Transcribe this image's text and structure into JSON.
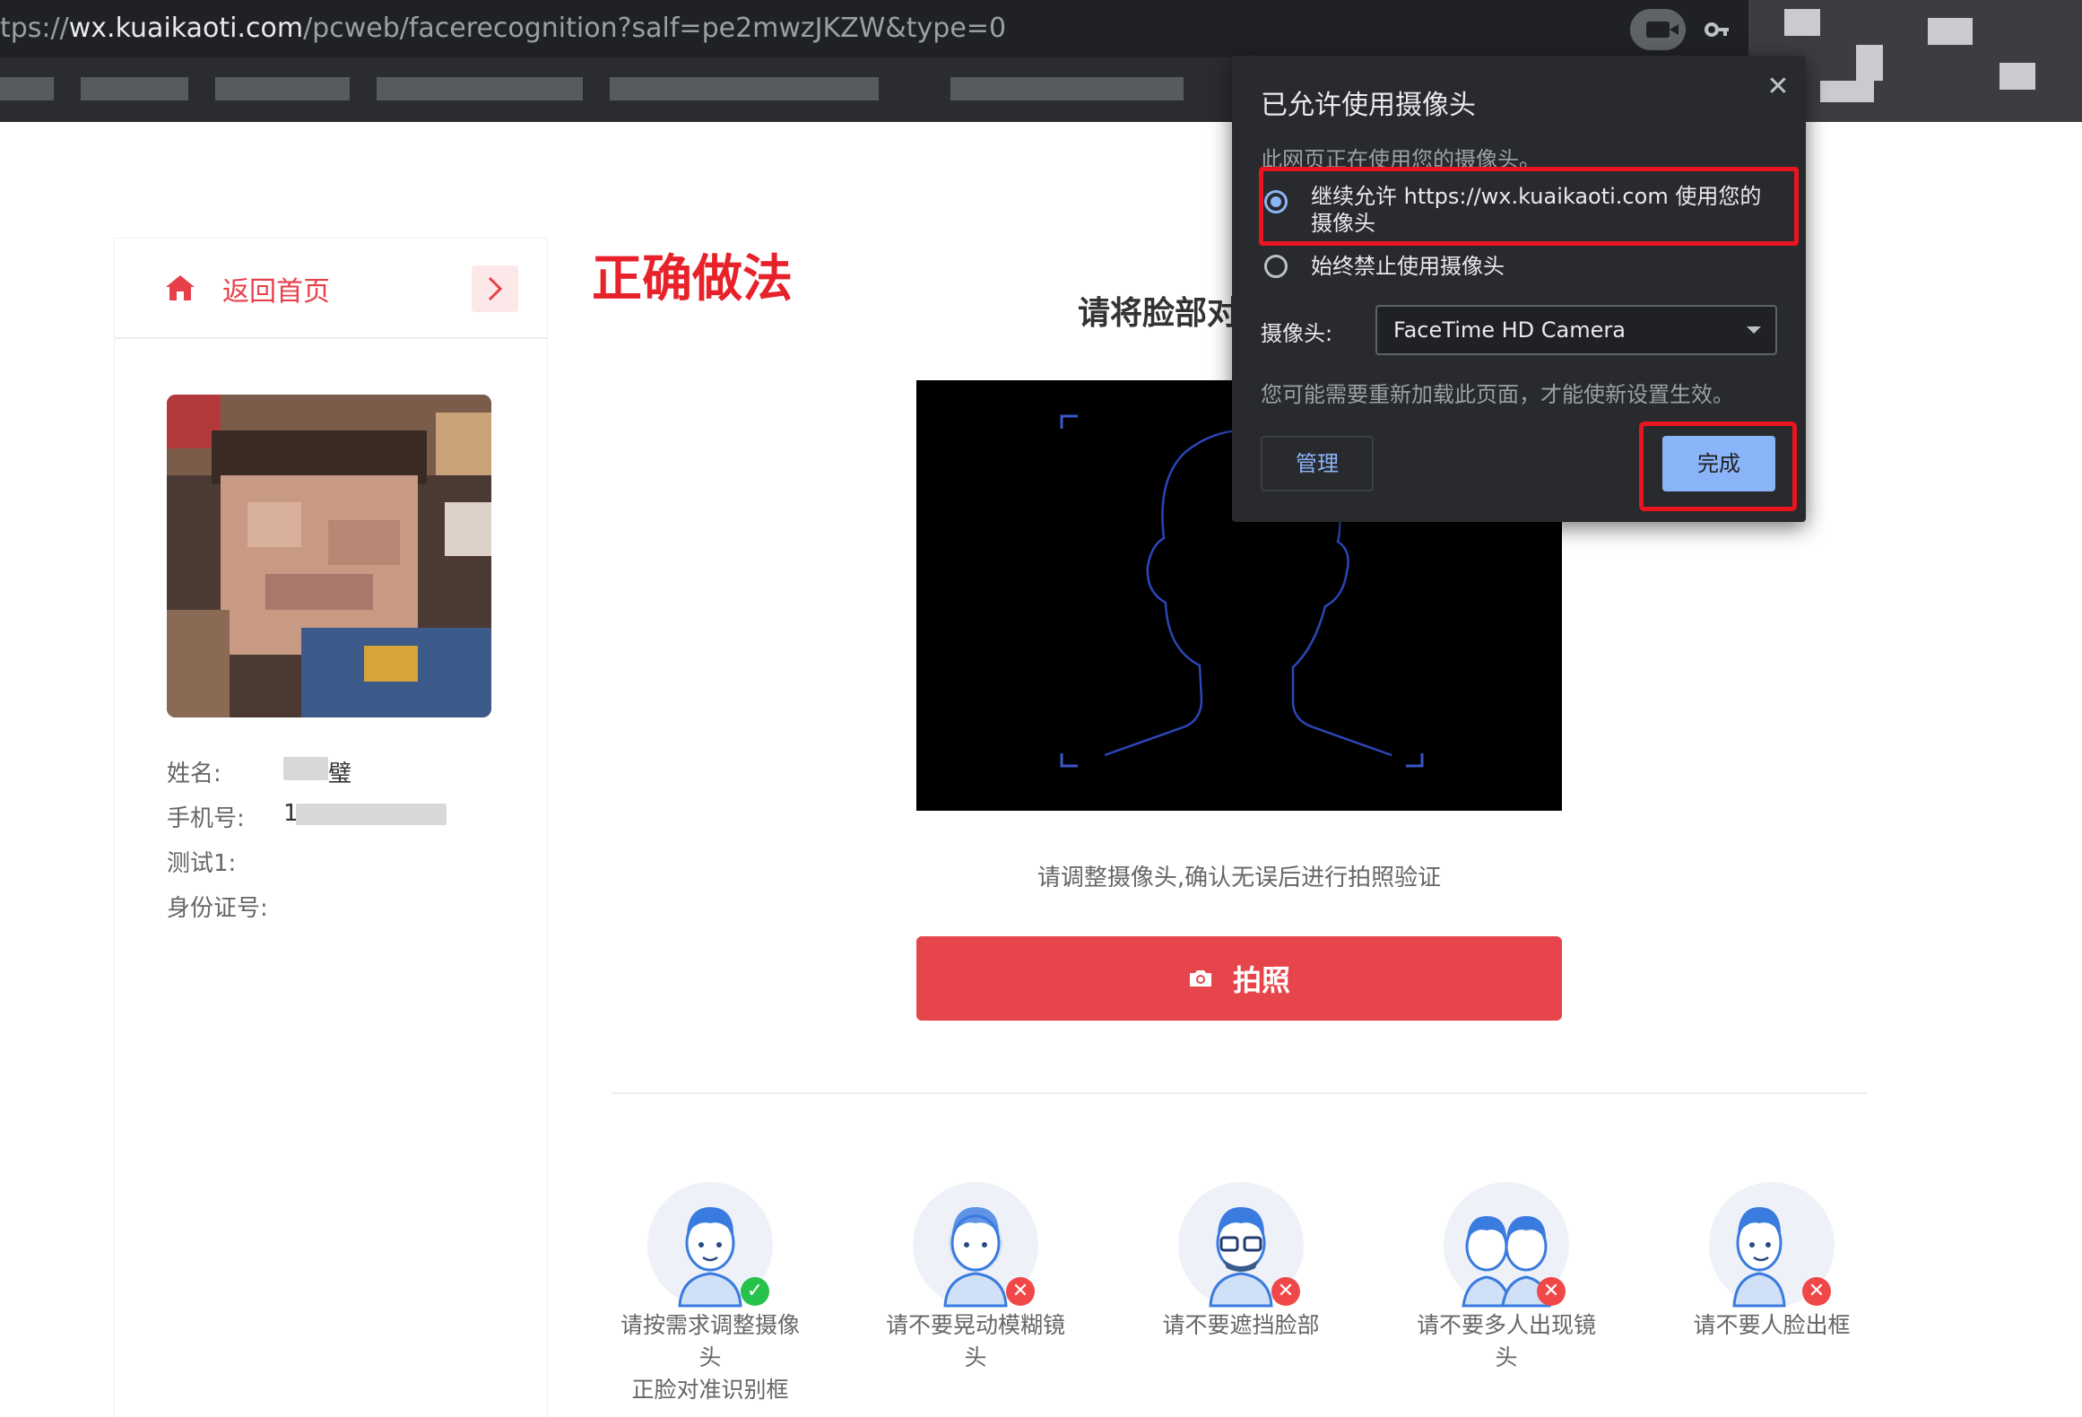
{
  "browser": {
    "url_prefix": "tps://",
    "url_host": "wx.kuaikaoti.com",
    "url_path": "/pcweb/facerecognition?salf=pe2mwzJKZW&type=0"
  },
  "sidebar": {
    "home_label": "返回首页",
    "fields": [
      {
        "label": "姓名:",
        "value": "璧"
      },
      {
        "label": "手机号:",
        "value": "1"
      },
      {
        "label": "测试1:",
        "value": ""
      },
      {
        "label": "身份证号:",
        "value": ""
      }
    ]
  },
  "main": {
    "annotation": "正确做法",
    "instruction": "请将脸部对",
    "hint": "请调整摄像头,确认无误后进行拍照验证",
    "capture_label": "拍照"
  },
  "tips": [
    {
      "line1": "请按需求调整摄像头",
      "line2": "正脸对准识别框",
      "status": "ok"
    },
    {
      "line1": "请不要晃动模糊镜头",
      "line2": "",
      "status": "no"
    },
    {
      "line1": "请不要遮挡脸部",
      "line2": "",
      "status": "no"
    },
    {
      "line1": "请不要多人出现镜头",
      "line2": "",
      "status": "no"
    },
    {
      "line1": "请不要人脸出框",
      "line2": "",
      "status": "no"
    }
  ],
  "popup": {
    "title": "已允许使用摄像头",
    "subtitle": "此网页正在使用您的摄像头。",
    "option_allow": "继续允许 https://wx.kuaikaoti.com 使用您的摄像头",
    "option_block": "始终禁止使用摄像头",
    "camera_label": "摄像头:",
    "camera_value": "FaceTime HD Camera",
    "note": "您可能需要重新加载此页面，才能使新设置生效。",
    "manage_label": "管理",
    "done_label": "完成",
    "close_glyph": "✕"
  },
  "colors": {
    "accent_red": "#e6454b",
    "annotation_red": "#e8222b",
    "popup_bg": "#292a2d",
    "link_blue": "#8ab4f8"
  }
}
